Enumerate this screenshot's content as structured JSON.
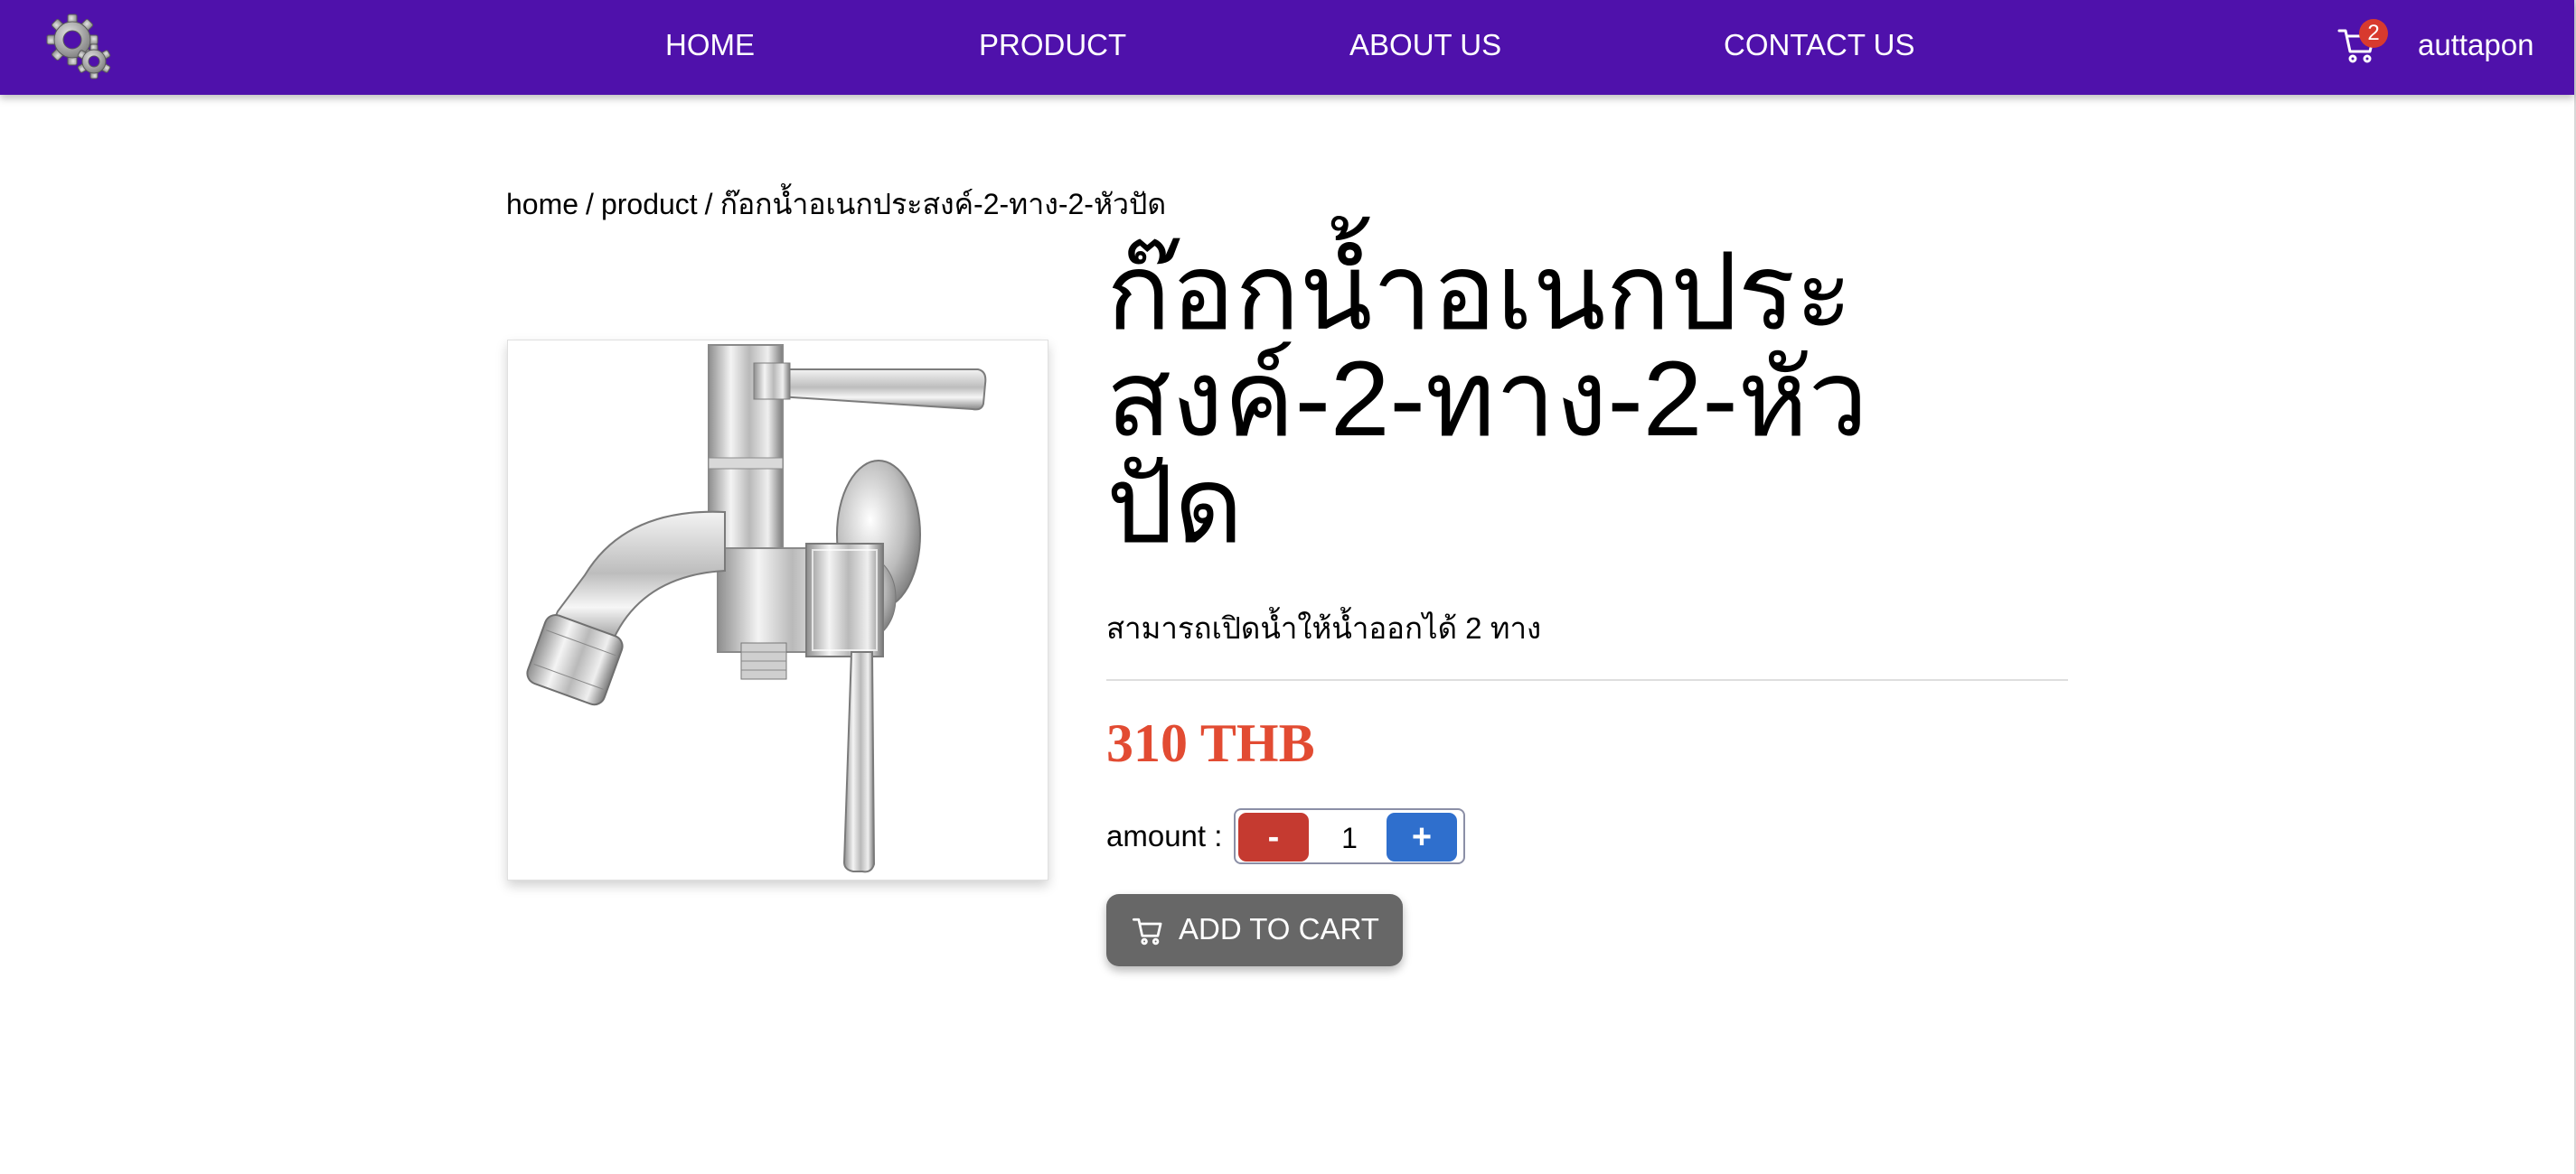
{
  "nav": {
    "links": [
      "HOME",
      "PRODUCT",
      "ABOUT US",
      "CONTACT US"
    ],
    "cart_count": "2",
    "username": "auttapon",
    "logo_icon": "gears-icon",
    "cart_icon": "cart-icon"
  },
  "breadcrumb": {
    "home": "home",
    "separator": "/",
    "product": "product",
    "current": "ก๊อกน้ำอเนกประสงค์-2-ทาง-2-หัวปัด"
  },
  "product": {
    "title": "ก๊อกน้ำอเนกประสงค์-2-ทาง-2-หัวปัด",
    "description": "สามารถเปิดน้ำให้น้ำออกได้ 2 ทาง",
    "price": "310 THB",
    "image_icon": "faucet-image"
  },
  "order": {
    "amount_label": "amount :",
    "minus_label": "-",
    "plus_label": "+",
    "quantity": "1",
    "add_to_cart_label": "ADD TO CART"
  },
  "colors": {
    "navbar": "#4f11ab",
    "price": "#e24b32",
    "minus_button": "#c53a30",
    "plus_button": "#2f6fcd",
    "add_to_cart_button": "#676767",
    "cart_badge": "#d83a2e"
  }
}
